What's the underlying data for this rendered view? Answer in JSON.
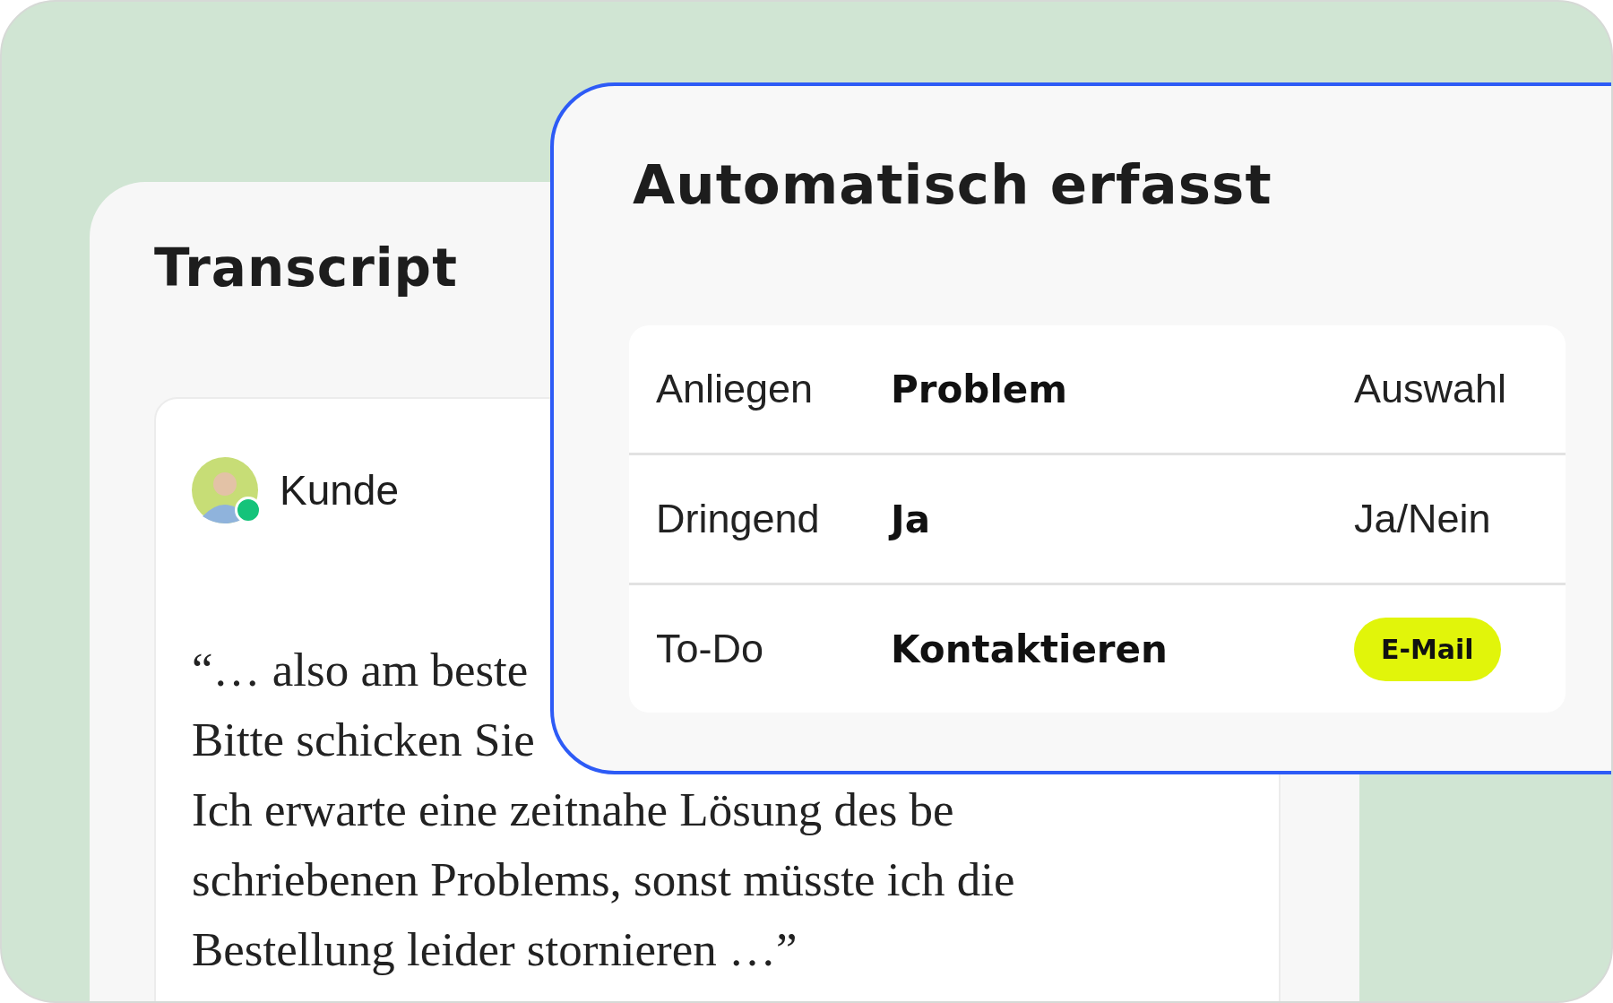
{
  "transcript": {
    "title": "Transcript",
    "speaker": {
      "name": "Kunde",
      "online": true
    },
    "quote_lines": [
      "“… also am beste",
      "Bitte schicken Sie",
      "Ich erwarte eine zeitnahe Lösung des be",
      "schriebenen Problems, sonst müsste ich die",
      "Bestellung leider stornieren …”"
    ]
  },
  "captured": {
    "title": "Automatisch erfasst",
    "rows": [
      {
        "label": "Anliegen",
        "value": "Problem",
        "field_type": {
          "kind": "text",
          "text": "Auswahl"
        }
      },
      {
        "label": "Dringend",
        "value": "Ja",
        "field_type": {
          "kind": "text",
          "text": "Ja/Nein"
        }
      },
      {
        "label": "To-Do",
        "value": "Kontaktieren",
        "field_type": {
          "kind": "tag",
          "text": "E-Mail"
        }
      }
    ]
  }
}
